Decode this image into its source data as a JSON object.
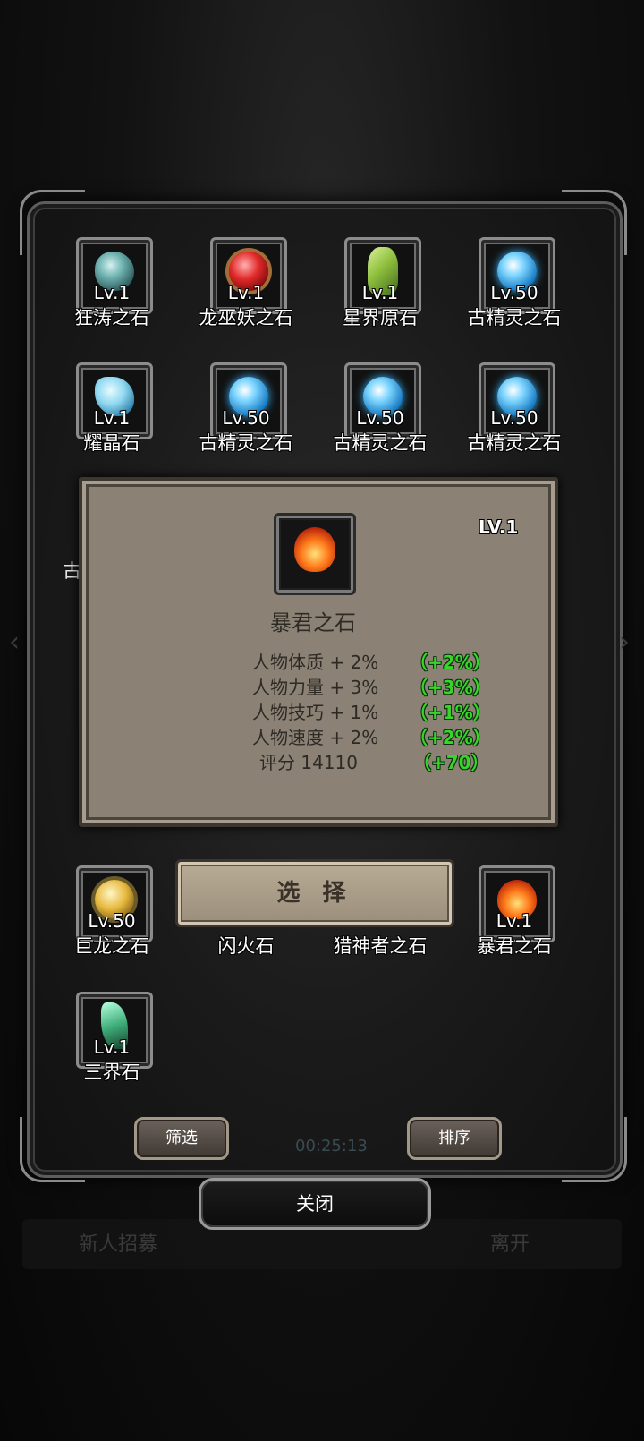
{
  "background": {
    "left_button": "新人招募",
    "right_button": "离开",
    "time_text": "00:25:13"
  },
  "items": [
    {
      "level": "Lv.1",
      "name": "狂涛之石",
      "gem": "teal-stone-icon"
    },
    {
      "level": "Lv.1",
      "name": "龙巫妖之石",
      "gem": "red-orb-icon"
    },
    {
      "level": "Lv.1",
      "name": "星界原石",
      "gem": "green-crystal-icon"
    },
    {
      "level": "Lv.50",
      "name": "古精灵之石",
      "gem": "blue-orb-icon"
    },
    {
      "level": "Lv.1",
      "name": "耀晶石",
      "gem": "ice-crystal-icon"
    },
    {
      "level": "Lv.50",
      "name": "古精灵之石",
      "gem": "blue-orb-icon"
    },
    {
      "level": "Lv.50",
      "name": "古精灵之石",
      "gem": "blue-orb-icon"
    },
    {
      "level": "Lv.50",
      "name": "古精灵之石",
      "gem": "blue-orb-icon"
    },
    {
      "level": "Lv.50",
      "name": "巨龙之石",
      "gem": "gold-orb-icon"
    },
    {
      "level": "",
      "name": "闪火石",
      "gem": ""
    },
    {
      "level": "",
      "name": "猎神者之石",
      "gem": ""
    },
    {
      "level": "Lv.1",
      "name": "暴君之石",
      "gem": "fire-stone-icon"
    },
    {
      "level": "Lv.1",
      "name": "三界石",
      "gem": "shard-stone-icon"
    }
  ],
  "partial_label": "古",
  "popup": {
    "level": "LV.1",
    "title": "暴君之石",
    "icon": "fire-stone-icon",
    "stats": [
      {
        "label": "人物体质 + 2%",
        "bonus": "（+2%）"
      },
      {
        "label": "人物力量 + 3%",
        "bonus": "（+3%）"
      },
      {
        "label": "人物技巧 + 1%",
        "bonus": "（+1%）"
      },
      {
        "label": "人物速度 + 2%",
        "bonus": "（+2%）"
      },
      {
        "label": "评分 14110",
        "bonus": "（+70）"
      }
    ],
    "select_button": "选 择"
  },
  "footer": {
    "filter_button": "筛选",
    "sort_button": "排序",
    "close_button": "关闭"
  }
}
